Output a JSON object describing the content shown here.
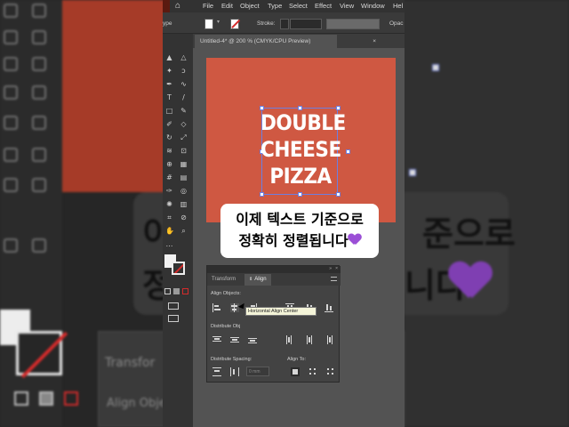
{
  "menubar": {
    "items": [
      "File",
      "Edit",
      "Object",
      "Type",
      "Select",
      "Effect",
      "View",
      "Window",
      "Hel"
    ]
  },
  "controlbar": {
    "type_label": "ype",
    "stroke_label": "Stroke:",
    "opacity_label": "Opac"
  },
  "document": {
    "tab_title": "Untitled-4* @ 200 % (CMYK/CPU Preview)",
    "close_glyph": "×"
  },
  "artwork": {
    "line1": "DOUBLE",
    "line2": "CHEESE",
    "line3": "PIZZA",
    "bg_color": "#cf5842"
  },
  "align_panel": {
    "tab_transform": "Transform",
    "tab_align": "Align",
    "align_objects": "Align Objects:",
    "distribute_objects": "Distribute Obj",
    "distribute_spacing": "Distribute Spacing:",
    "align_to": "Align To:",
    "spacing_value": "0 mm",
    "tooltip": "Horizontal Align Center"
  },
  "caption": {
    "line1": "이제 텍스트 기준으로",
    "line2": "정확히 정렬됩니다",
    "emoji": "purple-heart"
  },
  "background": {
    "transform_label": "Transfor",
    "align_objects_label": "Align Obje",
    "bubble_text_1": "이",
    "bubble_text_2": "준으로",
    "bubble_text_3": "정",
    "bubble_text_4": "니다"
  }
}
